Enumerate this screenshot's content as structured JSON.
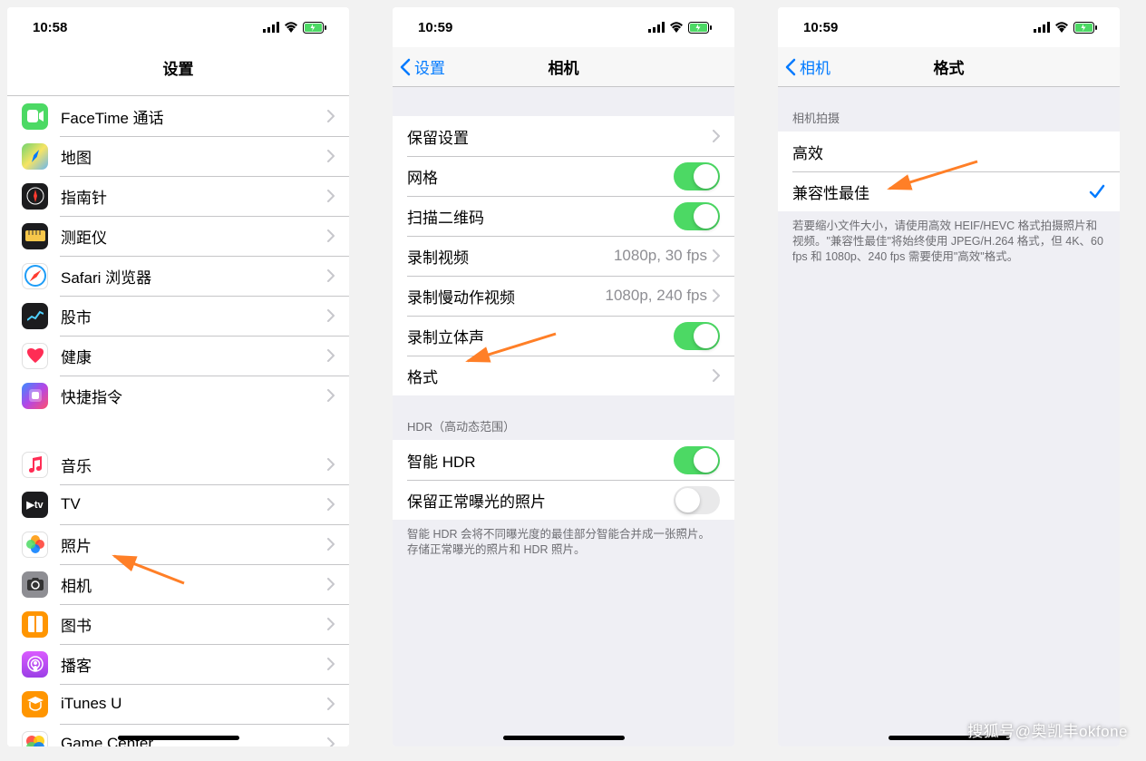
{
  "watermark": "搜狐号@奥凯丰okfone",
  "phone1": {
    "time": "10:58",
    "title": "设置",
    "items": [
      {
        "icon": "facetime",
        "label": "FaceTime 通话",
        "bg": "#4cd964"
      },
      {
        "icon": "maps",
        "label": "地图",
        "bg": "linear-gradient(135deg,#6fd36f,#f7e463,#69b7f0)"
      },
      {
        "icon": "compass",
        "label": "指南针",
        "bg": "#1c1c1e"
      },
      {
        "icon": "measure",
        "label": "测距仪",
        "bg": "#1c1c1e"
      },
      {
        "icon": "safari",
        "label": "Safari 浏览器",
        "bg": "#fff"
      },
      {
        "icon": "stocks",
        "label": "股市",
        "bg": "#1c1c1e"
      },
      {
        "icon": "health",
        "label": "健康",
        "bg": "#fff"
      },
      {
        "icon": "shortcuts",
        "label": "快捷指令",
        "bg": "linear-gradient(135deg,#3a8cff,#b347e6,#ff4f6e)"
      }
    ],
    "items2": [
      {
        "icon": "music",
        "label": "音乐",
        "bg": "#fff"
      },
      {
        "icon": "tv",
        "label": "TV",
        "bg": "#1c1c1e"
      },
      {
        "icon": "photos",
        "label": "照片",
        "bg": "#fff"
      },
      {
        "icon": "camera",
        "label": "相机",
        "bg": "#8e8e93"
      },
      {
        "icon": "books",
        "label": "图书",
        "bg": "#ff9500"
      },
      {
        "icon": "podcasts",
        "label": "播客",
        "bg": "linear-gradient(180deg,#da5bff,#9b3fe6)"
      },
      {
        "icon": "itunesu",
        "label": "iTunes U",
        "bg": "#ff9500"
      },
      {
        "icon": "gamecenter",
        "label": "Game Center",
        "bg": "#fff"
      }
    ]
  },
  "phone2": {
    "time": "10:59",
    "back": "设置",
    "title": "相机",
    "rows": [
      {
        "label": "保留设置",
        "type": "chevron"
      },
      {
        "label": "网格",
        "type": "toggle",
        "on": true
      },
      {
        "label": "扫描二维码",
        "type": "toggle",
        "on": true
      },
      {
        "label": "录制视频",
        "type": "detail",
        "detail": "1080p, 30 fps"
      },
      {
        "label": "录制慢动作视频",
        "type": "detail",
        "detail": "1080p, 240 fps"
      },
      {
        "label": "录制立体声",
        "type": "toggle",
        "on": true
      },
      {
        "label": "格式",
        "type": "chevron"
      }
    ],
    "section2_header": "HDR（高动态范围）",
    "rows2": [
      {
        "label": "智能 HDR",
        "type": "toggle",
        "on": true
      },
      {
        "label": "保留正常曝光的照片",
        "type": "toggle",
        "on": false
      }
    ],
    "footer": "智能 HDR 会将不同曝光度的最佳部分智能合并成一张照片。存储正常曝光的照片和 HDR 照片。"
  },
  "phone3": {
    "time": "10:59",
    "back": "相机",
    "title": "格式",
    "section_header": "相机拍摄",
    "rows": [
      {
        "label": "高效",
        "checked": false
      },
      {
        "label": "兼容性最佳",
        "checked": true
      }
    ],
    "footer": "若要缩小文件大小，请使用高效 HEIF/HEVC 格式拍摄照片和视频。\"兼容性最佳\"将始终使用 JPEG/H.264 格式，但 4K、60 fps 和 1080p、240 fps 需要使用\"高效\"格式。"
  }
}
